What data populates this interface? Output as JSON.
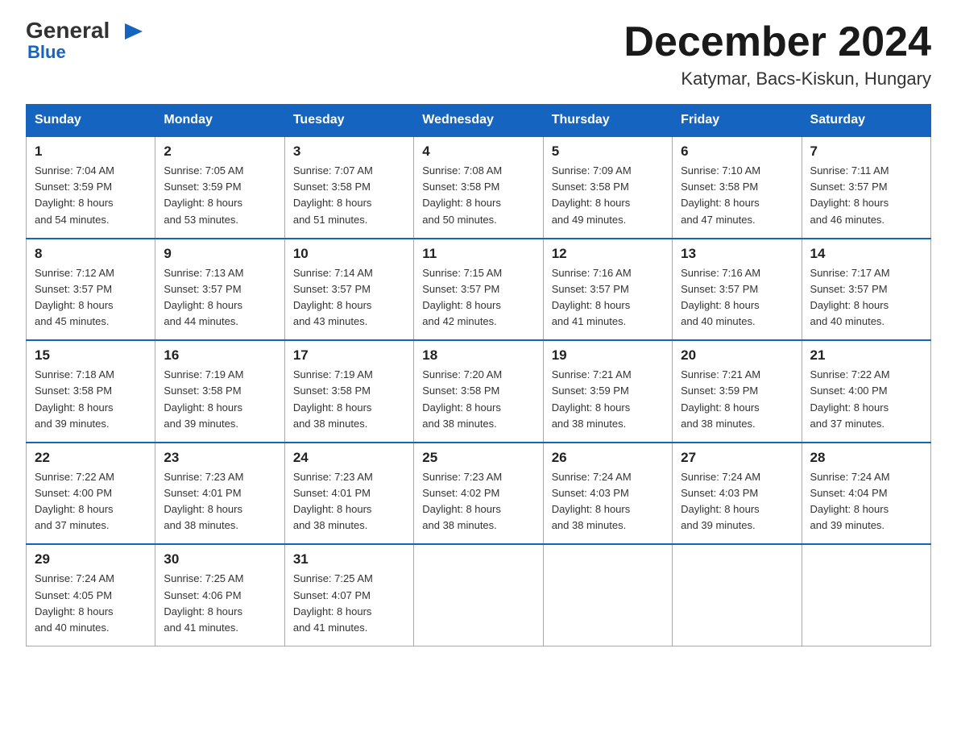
{
  "logo": {
    "general": "General",
    "triangle": "▶",
    "blue": "Blue"
  },
  "header": {
    "month": "December 2024",
    "location": "Katymar, Bacs-Kiskun, Hungary"
  },
  "weekdays": [
    "Sunday",
    "Monday",
    "Tuesday",
    "Wednesday",
    "Thursday",
    "Friday",
    "Saturday"
  ],
  "weeks": [
    [
      {
        "day": "1",
        "sunrise": "7:04 AM",
        "sunset": "3:59 PM",
        "daylight": "8 hours and 54 minutes."
      },
      {
        "day": "2",
        "sunrise": "7:05 AM",
        "sunset": "3:59 PM",
        "daylight": "8 hours and 53 minutes."
      },
      {
        "day": "3",
        "sunrise": "7:07 AM",
        "sunset": "3:58 PM",
        "daylight": "8 hours and 51 minutes."
      },
      {
        "day": "4",
        "sunrise": "7:08 AM",
        "sunset": "3:58 PM",
        "daylight": "8 hours and 50 minutes."
      },
      {
        "day": "5",
        "sunrise": "7:09 AM",
        "sunset": "3:58 PM",
        "daylight": "8 hours and 49 minutes."
      },
      {
        "day": "6",
        "sunrise": "7:10 AM",
        "sunset": "3:58 PM",
        "daylight": "8 hours and 47 minutes."
      },
      {
        "day": "7",
        "sunrise": "7:11 AM",
        "sunset": "3:57 PM",
        "daylight": "8 hours and 46 minutes."
      }
    ],
    [
      {
        "day": "8",
        "sunrise": "7:12 AM",
        "sunset": "3:57 PM",
        "daylight": "8 hours and 45 minutes."
      },
      {
        "day": "9",
        "sunrise": "7:13 AM",
        "sunset": "3:57 PM",
        "daylight": "8 hours and 44 minutes."
      },
      {
        "day": "10",
        "sunrise": "7:14 AM",
        "sunset": "3:57 PM",
        "daylight": "8 hours and 43 minutes."
      },
      {
        "day": "11",
        "sunrise": "7:15 AM",
        "sunset": "3:57 PM",
        "daylight": "8 hours and 42 minutes."
      },
      {
        "day": "12",
        "sunrise": "7:16 AM",
        "sunset": "3:57 PM",
        "daylight": "8 hours and 41 minutes."
      },
      {
        "day": "13",
        "sunrise": "7:16 AM",
        "sunset": "3:57 PM",
        "daylight": "8 hours and 40 minutes."
      },
      {
        "day": "14",
        "sunrise": "7:17 AM",
        "sunset": "3:57 PM",
        "daylight": "8 hours and 40 minutes."
      }
    ],
    [
      {
        "day": "15",
        "sunrise": "7:18 AM",
        "sunset": "3:58 PM",
        "daylight": "8 hours and 39 minutes."
      },
      {
        "day": "16",
        "sunrise": "7:19 AM",
        "sunset": "3:58 PM",
        "daylight": "8 hours and 39 minutes."
      },
      {
        "day": "17",
        "sunrise": "7:19 AM",
        "sunset": "3:58 PM",
        "daylight": "8 hours and 38 minutes."
      },
      {
        "day": "18",
        "sunrise": "7:20 AM",
        "sunset": "3:58 PM",
        "daylight": "8 hours and 38 minutes."
      },
      {
        "day": "19",
        "sunrise": "7:21 AM",
        "sunset": "3:59 PM",
        "daylight": "8 hours and 38 minutes."
      },
      {
        "day": "20",
        "sunrise": "7:21 AM",
        "sunset": "3:59 PM",
        "daylight": "8 hours and 38 minutes."
      },
      {
        "day": "21",
        "sunrise": "7:22 AM",
        "sunset": "4:00 PM",
        "daylight": "8 hours and 37 minutes."
      }
    ],
    [
      {
        "day": "22",
        "sunrise": "7:22 AM",
        "sunset": "4:00 PM",
        "daylight": "8 hours and 37 minutes."
      },
      {
        "day": "23",
        "sunrise": "7:23 AM",
        "sunset": "4:01 PM",
        "daylight": "8 hours and 38 minutes."
      },
      {
        "day": "24",
        "sunrise": "7:23 AM",
        "sunset": "4:01 PM",
        "daylight": "8 hours and 38 minutes."
      },
      {
        "day": "25",
        "sunrise": "7:23 AM",
        "sunset": "4:02 PM",
        "daylight": "8 hours and 38 minutes."
      },
      {
        "day": "26",
        "sunrise": "7:24 AM",
        "sunset": "4:03 PM",
        "daylight": "8 hours and 38 minutes."
      },
      {
        "day": "27",
        "sunrise": "7:24 AM",
        "sunset": "4:03 PM",
        "daylight": "8 hours and 39 minutes."
      },
      {
        "day": "28",
        "sunrise": "7:24 AM",
        "sunset": "4:04 PM",
        "daylight": "8 hours and 39 minutes."
      }
    ],
    [
      {
        "day": "29",
        "sunrise": "7:24 AM",
        "sunset": "4:05 PM",
        "daylight": "8 hours and 40 minutes."
      },
      {
        "day": "30",
        "sunrise": "7:25 AM",
        "sunset": "4:06 PM",
        "daylight": "8 hours and 41 minutes."
      },
      {
        "day": "31",
        "sunrise": "7:25 AM",
        "sunset": "4:07 PM",
        "daylight": "8 hours and 41 minutes."
      },
      null,
      null,
      null,
      null
    ]
  ],
  "labels": {
    "sunrise": "Sunrise:",
    "sunset": "Sunset:",
    "daylight": "Daylight:"
  }
}
